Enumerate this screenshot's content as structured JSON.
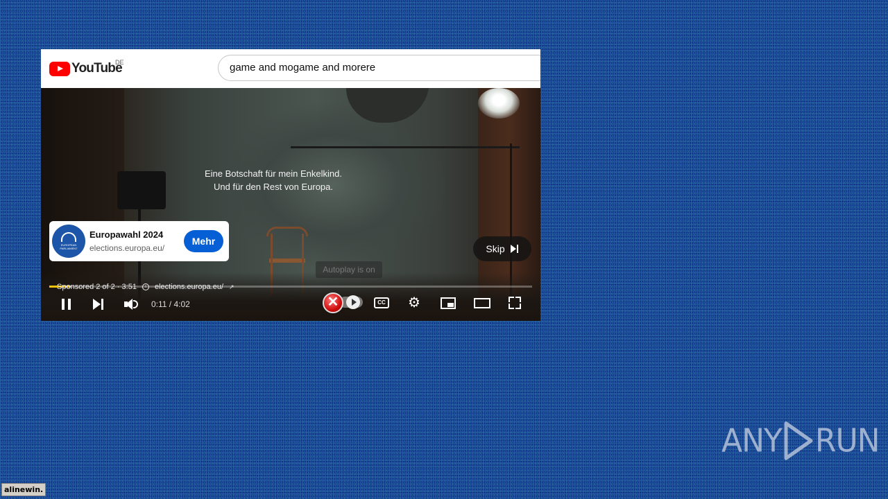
{
  "header": {
    "logo_text": "YouTube",
    "region_code": "DE",
    "search_value": "game and mogame and morere"
  },
  "video": {
    "caption_line1": "Eine Botschaft für mein Enkelkind.",
    "caption_line2": "Und für den Rest von Europa."
  },
  "ad_card": {
    "avatar_text": "EUROPEAN PARLIAMENT",
    "title": "Europawahl 2024",
    "url": "elections.europa.eu/",
    "cta_label": "Mehr"
  },
  "skip": {
    "label": "Skip"
  },
  "autoplay_tooltip": "Autoplay is on",
  "player": {
    "ad_position": "Sponsored 2 of 2 · 3:51",
    "ad_domain": "elections.europa.eu/",
    "time": "0:11 / 4:02",
    "progress": 0.045,
    "cc_label": "CC",
    "accent_color": "#f4c20d"
  },
  "icons": [
    "pause-icon",
    "next-icon",
    "volume-icon",
    "close-x-icon",
    "autoplay-icon",
    "cc-icon",
    "gear-icon",
    "miniplayer-icon",
    "theater-icon",
    "fullscreen-icon",
    "info-icon",
    "external-link-icon",
    "skip-icon"
  ],
  "watermark": {
    "left": "ANY",
    "right": "RUN"
  },
  "host_tag": "alinewin."
}
